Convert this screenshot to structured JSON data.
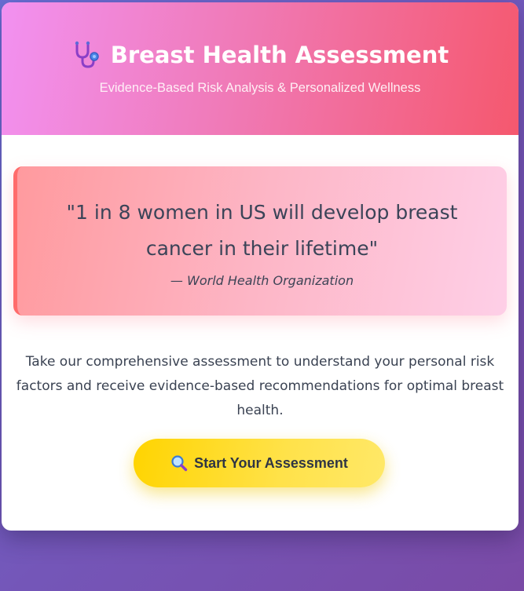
{
  "header": {
    "title": "Breast Health Assessment",
    "subtitle": "Evidence-Based Risk Analysis & Personalized Wellness",
    "icon": "stethoscope-icon"
  },
  "quote": {
    "text": "\"1 in 8 women in US will develop breast cancer in their lifetime\"",
    "source": "— World Health Organization"
  },
  "description": "Take our comprehensive assessment to understand your personal risk factors and receive evidence-based recommendations for optimal breast health.",
  "cta": {
    "label": "Start Your Assessment",
    "icon": "magnifier-icon"
  },
  "colors": {
    "header_gradient_start": "#f291f1",
    "header_gradient_end": "#f5586e",
    "quote_accent": "#ff6b6b",
    "cta_yellow": "#ffd400",
    "page_background": "#7456b8"
  }
}
